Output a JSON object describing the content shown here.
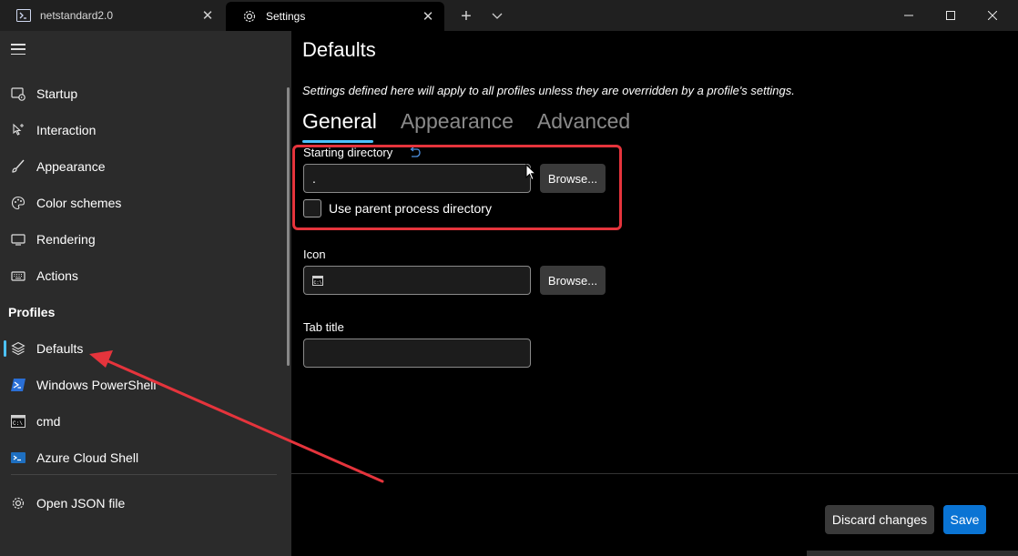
{
  "window": {
    "tabs": [
      {
        "label": "netstandard2.0",
        "icon": "powershell-icon"
      },
      {
        "label": "Settings",
        "icon": "gear-icon"
      }
    ]
  },
  "sidebar": {
    "items": [
      {
        "label": "Startup",
        "icon": "startup-icon"
      },
      {
        "label": "Interaction",
        "icon": "interaction-icon"
      },
      {
        "label": "Appearance",
        "icon": "brush-icon"
      },
      {
        "label": "Color schemes",
        "icon": "palette-icon"
      },
      {
        "label": "Rendering",
        "icon": "monitor-icon"
      },
      {
        "label": "Actions",
        "icon": "keyboard-icon"
      }
    ],
    "profiles_header": "Profiles",
    "profiles": [
      {
        "label": "Defaults",
        "icon": "layers-icon",
        "selected": true
      },
      {
        "label": "Windows PowerShell",
        "icon": "powershell-icon"
      },
      {
        "label": "cmd",
        "icon": "cmd-icon"
      },
      {
        "label": "Azure Cloud Shell",
        "icon": "azure-icon"
      }
    ],
    "open_json": {
      "label": "Open JSON file",
      "icon": "gear-icon"
    }
  },
  "main": {
    "title": "Defaults",
    "description": "Settings defined here will apply to all profiles unless they are overridden by a profile's settings.",
    "tabs": [
      {
        "label": "General",
        "active": true
      },
      {
        "label": "Appearance",
        "active": false
      },
      {
        "label": "Advanced",
        "active": false
      }
    ],
    "starting_directory": {
      "label": "Starting directory",
      "value": ".",
      "browse_label": "Browse...",
      "checkbox_label": "Use parent process directory",
      "checked": false
    },
    "icon_field": {
      "label": "Icon",
      "value": "",
      "browse_label": "Browse..."
    },
    "tab_title": {
      "label": "Tab title",
      "value": ""
    },
    "discard_label": "Discard changes",
    "save_label": "Save"
  },
  "colors": {
    "accent": "#4cc2ff",
    "save_button": "#0a74d4",
    "annotation": "#e5343c"
  }
}
